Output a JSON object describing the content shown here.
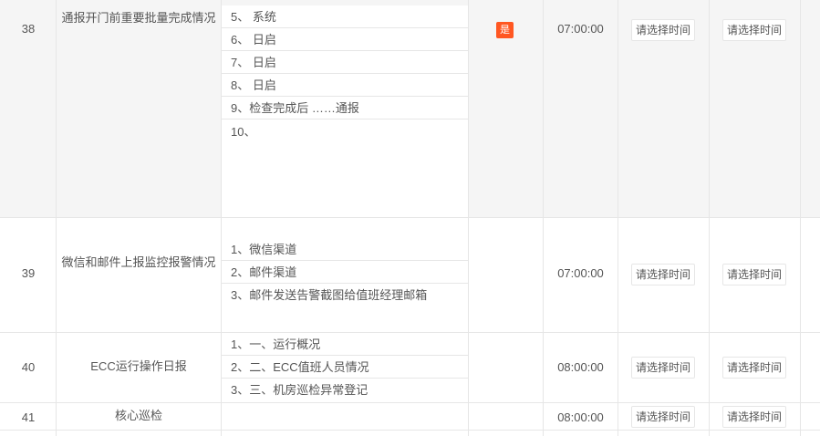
{
  "rows": [
    {
      "no": "38",
      "name": "通报开门前重要批量完成情况",
      "items": [
        "5、 系统",
        "6、 日启",
        "7、 日启",
        "8、 日启",
        "9、检查完成后 ……通报",
        "10、"
      ],
      "flag": "是",
      "time": "07:00:00",
      "btn1": "请选择时间",
      "btn2": "请选择时间"
    },
    {
      "no": "39",
      "name": "微信和邮件上报监控报警情况",
      "items": [
        "1、微信渠道",
        "2、邮件渠道",
        "3、邮件发送告警截图给值班经理邮箱"
      ],
      "time": "07:00:00",
      "btn1": "请选择时间",
      "btn2": "请选择时间"
    },
    {
      "no": "40",
      "name": "ECC运行操作日报",
      "items": [
        "1、一、运行概况",
        "2、二、ECC值班人员情况",
        "3、三、机房巡检异常登记"
      ],
      "time": "08:00:00",
      "btn1": "请选择时间",
      "btn2": "请选择时间"
    },
    {
      "no": "41",
      "name": "核心巡检",
      "items": [],
      "time": "08:00:00",
      "btn1": "请选择时间",
      "btn2": "请选择时间"
    }
  ],
  "colors": {
    "badge": "#ff5722",
    "border": "#e6e6e6",
    "shade": "#f5f5f5"
  }
}
